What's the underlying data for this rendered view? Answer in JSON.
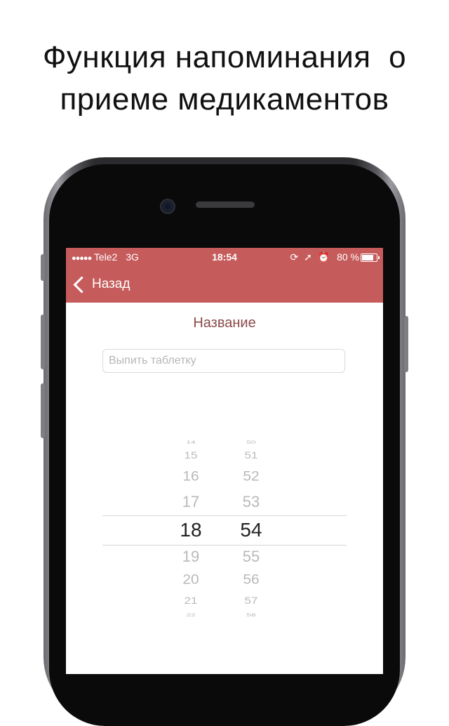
{
  "headline": {
    "line1": "Функция напоминания  о",
    "line2": "приеме медикаментов"
  },
  "status_bar": {
    "carrier": "Tele2",
    "network": "3G",
    "time": "18:54",
    "icons": [
      "lock-rotation-icon",
      "location-arrow-icon",
      "alarm-icon"
    ],
    "battery": "80 %"
  },
  "nav": {
    "back_label": "Назад",
    "color": "#c65b5b"
  },
  "form": {
    "title": "Название",
    "name_placeholder": "Выпить таблетку"
  },
  "picker": {
    "hours": [
      "14",
      "15",
      "16",
      "17",
      "18",
      "19",
      "20",
      "21",
      "22"
    ],
    "minutes": [
      "50",
      "51",
      "52",
      "53",
      "54",
      "55",
      "56",
      "57",
      "58"
    ],
    "selected_hour": "18",
    "selected_minute": "54"
  }
}
